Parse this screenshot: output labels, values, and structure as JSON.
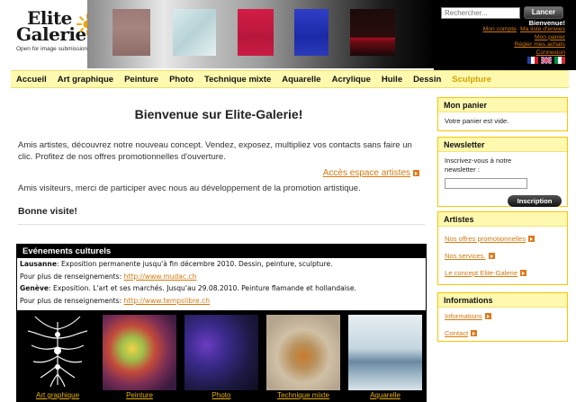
{
  "header": {
    "logo_line1": "Elite",
    "logo_line2": "Galerie",
    "tagline": "Open for image submissions"
  },
  "search": {
    "placeholder": "Rechercher...",
    "button_label": "Lancer"
  },
  "user": {
    "welcome": "Bienvenue!",
    "links": [
      "Mon compte",
      "Ma liste d'envies",
      "Mon panier",
      "Régler mes achats",
      "Connexion"
    ]
  },
  "languages": [
    "fr",
    "en",
    "it"
  ],
  "nav": {
    "items": [
      "Accueil",
      "Art graphique",
      "Peinture",
      "Photo",
      "Technique mixte",
      "Aquarelle",
      "Acrylique",
      "Huile",
      "Dessin",
      "Sculpture"
    ],
    "active": "Sculpture"
  },
  "main": {
    "title": "Bienvenue sur Elite-Galerie!",
    "intro": "Amis artistes, découvrez notre nouveau concept. Vendez, exposez, multipliez vos contacts sans faire un clic. Profitez de nos offres promotionnelles d'ouverture.",
    "access_link": "Accès espace artistes",
    "visitors": "Amis visiteurs, merci de participer avec nous au développement de la promotion artistique.",
    "good_visit": "Bonne visite!"
  },
  "events": {
    "title": "Evénements culturels",
    "items": [
      {
        "city": "Lausanne",
        "text": ": Exposition permanente jusqu'à fin décembre 2010. Dessin, peinture, sculpture.",
        "more_label": "Pour plus de renseignements:",
        "url": "http://www.mudac.ch"
      },
      {
        "city": "Genève",
        "text": ": Exposition. L'art et ses marchés. Jusqu'au 29.08.2010. Peinture flamande et hollandaise.",
        "more_label": "Pour plus de renseignements:",
        "url": "http://www.tempslibre.ch"
      }
    ]
  },
  "gallery": {
    "items": [
      "Art graphique",
      "Peinture",
      "Photo",
      "Technique mixte",
      "Aquarelle"
    ]
  },
  "sidebar": {
    "cart": {
      "title": "Mon panier",
      "text": "Votre panier est vide."
    },
    "newsletter": {
      "title": "Newsletter",
      "text": "Inscrivez-vous à notre newsletter :",
      "button_label": "Inscription"
    },
    "artists": {
      "title": "Artistes",
      "links": [
        "Nos offres promotionnelles",
        "Nos services.",
        "Le concept Elite-Galerie"
      ]
    },
    "info": {
      "title": "Informations",
      "links": [
        "Informations",
        "Contact"
      ]
    }
  },
  "colors": {
    "accent": "#d57a0f",
    "nav_bg": "#fff9b0",
    "box_border": "#ffc400",
    "active_nav": "#d4a300"
  }
}
